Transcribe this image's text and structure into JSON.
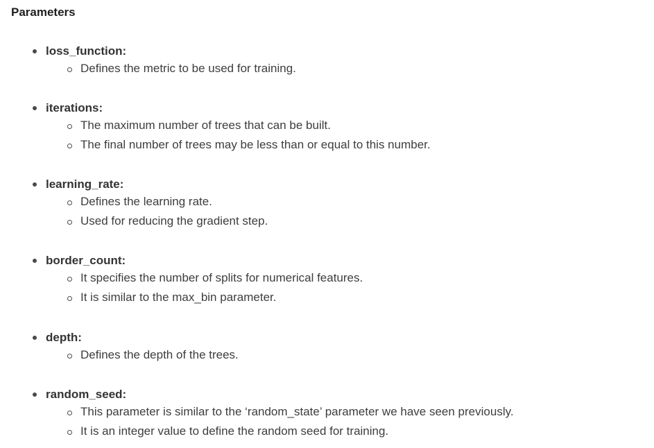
{
  "heading": "Parameters",
  "params": [
    {
      "name": "loss_function:",
      "items": [
        "Defines the metric to be used for training."
      ]
    },
    {
      "name": "iterations:",
      "items": [
        "The maximum number of trees that can be built.",
        "The final number of trees may be less than or equal to this number."
      ]
    },
    {
      "name": "learning_rate:",
      "items": [
        "Defines the learning rate.",
        "Used for reducing the gradient step."
      ]
    },
    {
      "name": "border_count:",
      "items": [
        "It specifies the number of splits for numerical features.",
        "It is similar to the max_bin parameter."
      ]
    },
    {
      "name": "depth:",
      "items": [
        "Defines the depth of the trees."
      ]
    },
    {
      "name": "random_seed:",
      "items": [
        "This parameter is similar to the ‘random_state’ parameter we have seen previously.",
        "It is an integer value to define the random seed for training."
      ]
    }
  ]
}
